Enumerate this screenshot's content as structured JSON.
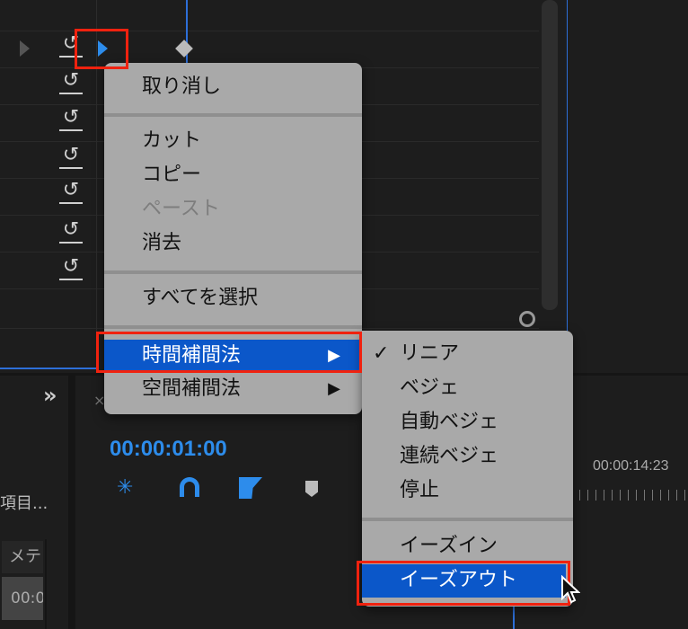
{
  "effect_controls": {
    "reset_rows": 7
  },
  "context_menu": {
    "items": [
      {
        "label": "取り消し"
      },
      {
        "label": "カット"
      },
      {
        "label": "コピー"
      },
      {
        "label": "ペースト",
        "disabled": true
      },
      {
        "label": "消去"
      },
      {
        "label": "すべてを選択"
      },
      {
        "label": "時間補間法",
        "highlighted": true
      },
      {
        "label": "空間補間法"
      }
    ]
  },
  "submenu": {
    "items": [
      {
        "label": "リニア",
        "checked": true
      },
      {
        "label": "ベジェ"
      },
      {
        "label": "自動ベジェ"
      },
      {
        "label": "連続ベジェ"
      },
      {
        "label": "停止"
      },
      {
        "label": "イーズイン"
      },
      {
        "label": "イーズアウト",
        "highlighted": true
      }
    ],
    "check": "✓"
  },
  "timeline": {
    "timecode": "00:00:01:00",
    "ruler_time": "00:00:14:23",
    "close": "×"
  },
  "left_panel": {
    "expand": "»",
    "item_label": "項目...",
    "col_header": "メテ",
    "cell": "00:0"
  },
  "colors": {
    "accent": "#2d8ceb",
    "highlight": "#0b57c9",
    "annotation": "#f0220f"
  }
}
